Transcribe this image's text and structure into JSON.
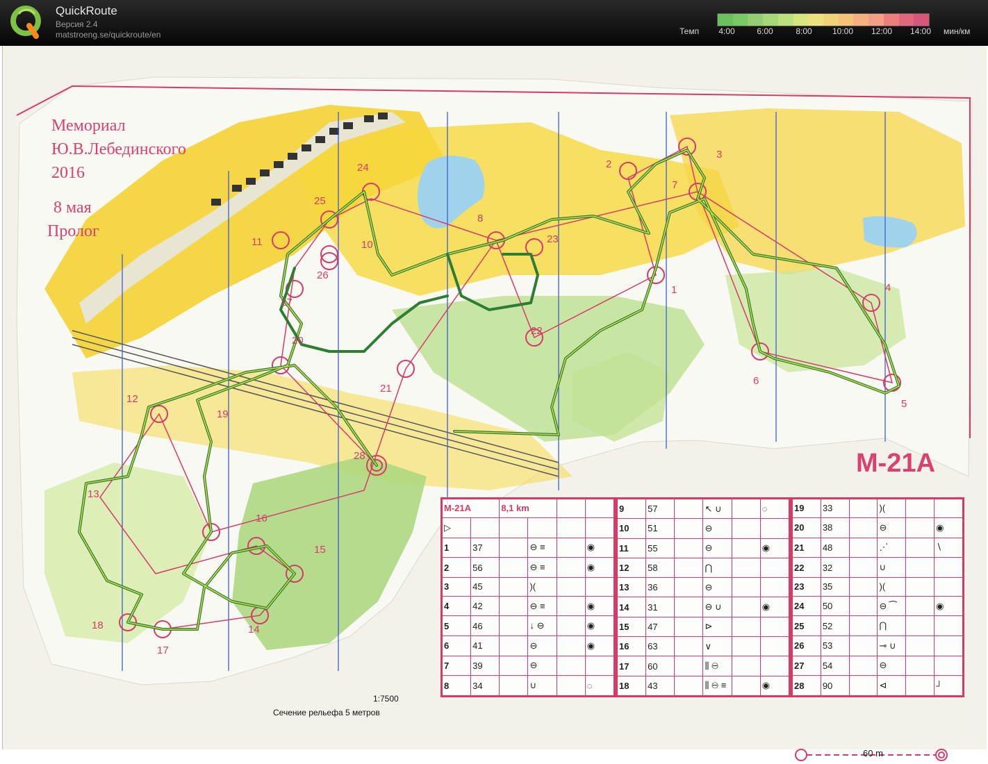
{
  "app": {
    "title": "QuickRoute",
    "version": "Версия 2.4",
    "url": "matstroeng.se/quickroute/en"
  },
  "pace_scale": {
    "label": "Темп",
    "ticks": [
      "4:00",
      "6:00",
      "8:00",
      "10:00",
      "12:00",
      "14:00"
    ],
    "unit": "мин/км",
    "colors": [
      "#6cbf5d",
      "#7cc766",
      "#93cf72",
      "#a6d879",
      "#bfe07e",
      "#d9e67f",
      "#ebe27d",
      "#f0d27a",
      "#f4c27a",
      "#f6b07d",
      "#f29f86",
      "#eb7f7b",
      "#e0677d",
      "#d6577a"
    ]
  },
  "map": {
    "title_lines": [
      "Мемориал",
      "Ю.В.Лебединского",
      "2016",
      "8 мая",
      "Пролог"
    ],
    "class_label": "M-21A",
    "scale_text": "1:7500",
    "contour_text": "Сечение рельефа 5 метров",
    "controls": [
      {
        "n": "1"
      },
      {
        "n": "2"
      },
      {
        "n": "3"
      },
      {
        "n": "4"
      },
      {
        "n": "5"
      },
      {
        "n": "6"
      },
      {
        "n": "7"
      },
      {
        "n": "8"
      },
      {
        "n": "10"
      },
      {
        "n": "12"
      },
      {
        "n": "13"
      },
      {
        "n": "14"
      },
      {
        "n": "15"
      },
      {
        "n": "16"
      },
      {
        "n": "17"
      },
      {
        "n": "18"
      },
      {
        "n": "19"
      },
      {
        "n": "20"
      },
      {
        "n": "21"
      },
      {
        "n": "22"
      },
      {
        "n": "23"
      },
      {
        "n": "24"
      },
      {
        "n": "25"
      },
      {
        "n": "26"
      },
      {
        "n": "27"
      },
      {
        "n": "28"
      },
      {
        "n": "11"
      }
    ]
  },
  "description_sheet": {
    "header": {
      "class": "M-21A",
      "distance": "8,1 km"
    },
    "columns": [
      [
        {
          "n": "1",
          "code": "37",
          "sym": "⊖ ≡",
          "extra": "◉"
        },
        {
          "n": "2",
          "code": "56",
          "sym": "⊖ ≡",
          "extra": "◉"
        },
        {
          "n": "3",
          "code": "45",
          "sym": ")(",
          "extra": ""
        },
        {
          "n": "4",
          "code": "42",
          "sym": "⊖ ≡",
          "extra": "◉"
        },
        {
          "n": "5",
          "code": "46",
          "sym": "↓ ⊖",
          "extra": "◉"
        },
        {
          "n": "6",
          "code": "41",
          "sym": "⊖",
          "extra": "◉"
        },
        {
          "n": "7",
          "code": "39",
          "sym": "⊖",
          "extra": ""
        },
        {
          "n": "8",
          "code": "34",
          "sym": "∪",
          "extra": "◌"
        }
      ],
      [
        {
          "n": "9",
          "code": "57",
          "sym": "↖ ∪",
          "extra": "◌"
        },
        {
          "n": "10",
          "code": "51",
          "sym": "⊖",
          "extra": ""
        },
        {
          "n": "11",
          "code": "55",
          "sym": "⊖",
          "extra": "◉"
        },
        {
          "n": "12",
          "code": "58",
          "sym": "⋂",
          "extra": ""
        },
        {
          "n": "13",
          "code": "36",
          "sym": "⊖",
          "extra": ""
        },
        {
          "n": "14",
          "code": "31",
          "sym": "⊖ ∪",
          "extra": "◉"
        },
        {
          "n": "15",
          "code": "47",
          "sym": "⊳",
          "extra": ""
        },
        {
          "n": "16",
          "code": "63",
          "sym": "∨",
          "extra": ""
        },
        {
          "n": "17",
          "code": "60",
          "sym": "⫼ ⊖",
          "extra": ""
        },
        {
          "n": "18",
          "code": "43",
          "sym": "⫼ ⊖ ≡",
          "extra": "◉"
        }
      ],
      [
        {
          "n": "19",
          "code": "33",
          "sym": ")(",
          "extra": ""
        },
        {
          "n": "20",
          "code": "38",
          "sym": "⊖",
          "extra": "◉"
        },
        {
          "n": "21",
          "code": "48",
          "sym": "⋰",
          "extra": "∖"
        },
        {
          "n": "22",
          "code": "32",
          "sym": "∪",
          "extra": ""
        },
        {
          "n": "23",
          "code": "35",
          "sym": ")(",
          "extra": ""
        },
        {
          "n": "24",
          "code": "50",
          "sym": "⊖ ⁀",
          "extra": "◉"
        },
        {
          "n": "25",
          "code": "52",
          "sym": "⋂",
          "extra": ""
        },
        {
          "n": "26",
          "code": "53",
          "sym": "⊸ ∪",
          "extra": ""
        },
        {
          "n": "27",
          "code": "54",
          "sym": "⊖",
          "extra": ""
        },
        {
          "n": "28",
          "code": "90",
          "sym": "⊲",
          "extra": "┘"
        }
      ]
    ],
    "footer_distance": "60 m"
  }
}
